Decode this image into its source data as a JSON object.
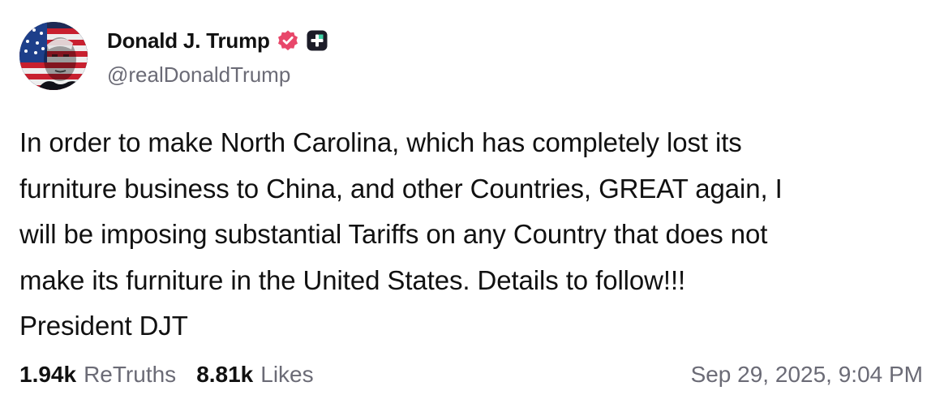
{
  "author": {
    "display_name": "Donald J. Trump",
    "handle": "@realDonaldTrump",
    "verified_icon": "verified-badge-icon",
    "verified_color": "#e8476a",
    "plus_icon": "plus-badge-icon"
  },
  "post": {
    "lines": [
      "In order to make North Carolina, which has completely lost its",
      "furniture business to China, and other Countries, GREAT again, I",
      "will be imposing substantial Tariffs on any Country that does not",
      "make its furniture in the United States. Details to follow!!!",
      "President DJT"
    ]
  },
  "stats": {
    "retruths_count": "1.94k",
    "retruths_label": "ReTruths",
    "likes_count": "8.81k",
    "likes_label": "Likes"
  },
  "timestamp": "Sep 29, 2025, 9:04 PM",
  "colors": {
    "text": "#111111",
    "muted": "#6b6b76",
    "verified": "#e8476a",
    "badge_dark": "#1c1c28"
  }
}
